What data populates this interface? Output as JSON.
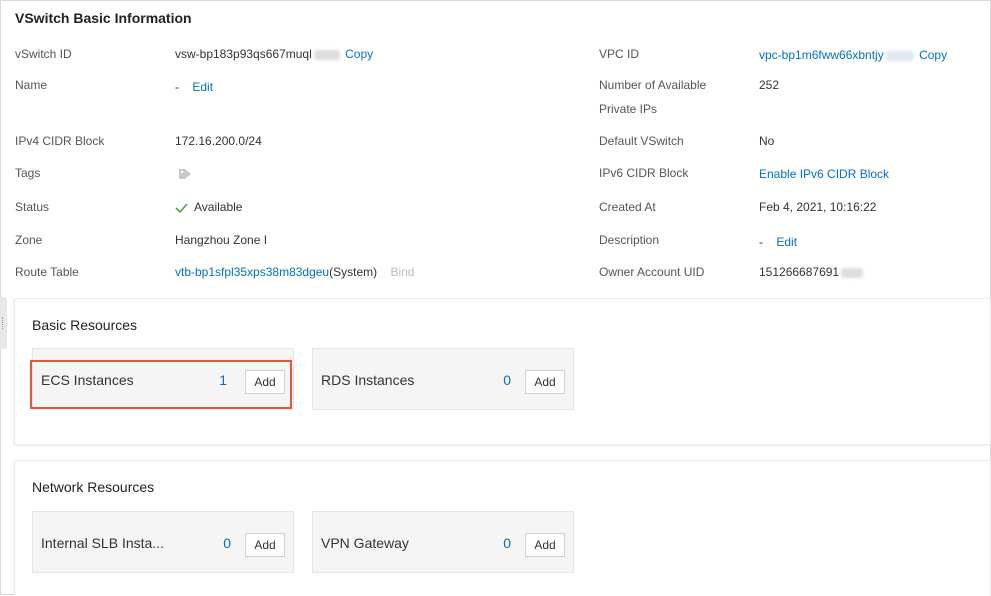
{
  "header": {
    "title": "VSwitch Basic Information"
  },
  "left_fields": {
    "vswitch_id": {
      "label": "vSwitch ID",
      "value": "vsw-bp183p93qs667muql",
      "action": "Copy"
    },
    "name": {
      "label": "Name",
      "value": "-",
      "action": "Edit"
    },
    "ipv4": {
      "label": "IPv4 CIDR Block",
      "value": "172.16.200.0/24"
    },
    "tags": {
      "label": "Tags",
      "icon": "tag-icon"
    },
    "status": {
      "label": "Status",
      "value": "Available",
      "icon": "check-icon",
      "color": "#52a352"
    },
    "zone": {
      "label": "Zone",
      "value": "Hangzhou Zone I"
    },
    "route_table": {
      "label": "Route Table",
      "value": "vtb-bp1sfpl35xps38m83dgeu",
      "suffix": "(System)",
      "action": "Bind"
    }
  },
  "right_fields": {
    "vpc_id": {
      "label": "VPC ID",
      "value": "vpc-bp1m6fww66xbntjy",
      "action": "Copy"
    },
    "available_ips": {
      "label_line1": "Number of Available",
      "label_line2": "Private IPs",
      "value": "252"
    },
    "default_vswitch": {
      "label": "Default VSwitch",
      "value": "No"
    },
    "ipv6": {
      "label": "IPv6 CIDR Block",
      "value": "Enable IPv6 CIDR Block"
    },
    "created_at": {
      "label": "Created At",
      "value": "Feb 4, 2021, 10:16:22"
    },
    "description": {
      "label": "Description",
      "value": "-",
      "action": "Edit"
    },
    "owner_uid": {
      "label": "Owner Account UID",
      "value": "151266687691"
    }
  },
  "basic_resources": {
    "title": "Basic Resources",
    "cards": [
      {
        "name": "ECS Instances",
        "count": "1",
        "button": "Add"
      },
      {
        "name": "RDS Instances",
        "count": "0",
        "button": "Add"
      }
    ]
  },
  "network_resources": {
    "title": "Network Resources",
    "cards": [
      {
        "name": "Internal SLB Insta...",
        "count": "0",
        "button": "Add"
      },
      {
        "name": "VPN Gateway",
        "count": "0",
        "button": "Add"
      }
    ]
  },
  "colors": {
    "link": "#0070cc",
    "highlight": "#e8543a",
    "success": "#52a352"
  }
}
